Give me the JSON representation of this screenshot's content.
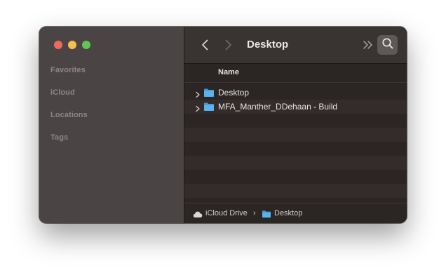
{
  "window": {
    "title": "Desktop"
  },
  "sidebar": {
    "sections": [
      {
        "label": "Favorites"
      },
      {
        "label": "iCloud"
      },
      {
        "label": "Locations"
      },
      {
        "label": "Tags"
      }
    ]
  },
  "toolbar": {
    "title": "Desktop",
    "back_icon": "chevron-left-icon",
    "forward_icon": "chevron-right-icon",
    "more_icon": "double-chevron-right-icon",
    "search_icon": "magnifying-glass-icon"
  },
  "list": {
    "column_header": "Name",
    "items": [
      {
        "name": "Desktop",
        "kind": "folder",
        "expandable": true
      },
      {
        "name": "MFA_Manther_DDehaan - Build",
        "kind": "folder",
        "expandable": true
      }
    ]
  },
  "pathbar": {
    "crumbs": [
      {
        "label": "iCloud Drive",
        "icon": "cloud-icon"
      },
      {
        "label": "Desktop",
        "icon": "folder-icon"
      }
    ],
    "separator": "›"
  },
  "colors": {
    "folder": "#5ab3ec",
    "folder_tab": "#3f99d8",
    "close": "#ed6a5e",
    "minimize": "#f5bf4f",
    "zoom": "#61c554"
  }
}
